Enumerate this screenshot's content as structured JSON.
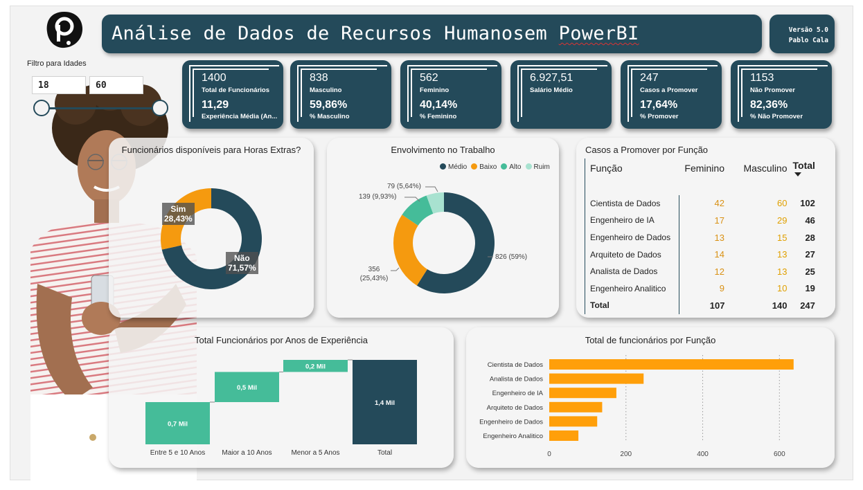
{
  "header": {
    "title": "Análise de Dados de Recursos Humanos",
    "title_suffix": "em ",
    "title_brand": "PowerBI",
    "version": "Versão 5.0",
    "author": "Pablo Cala"
  },
  "filter": {
    "label": "Filtro para Idades",
    "min_age": "18",
    "max_age": "60"
  },
  "kpis": [
    {
      "value": "1400",
      "label": "Total de Funcionários",
      "value2": "11,29",
      "label2": "Experiência Média (An..."
    },
    {
      "value": "838",
      "label": "Masculino",
      "value2": "59,86%",
      "label2": "% Masculino"
    },
    {
      "value": "562",
      "label": "Feminino",
      "value2": "40,14%",
      "label2": "% Feminino"
    },
    {
      "value": "6.927,51",
      "label": "Salário Médio",
      "value2": "",
      "label2": ""
    },
    {
      "value": "247",
      "label": "Casos a Promover",
      "value2": "17,64%",
      "label2": "% Promover"
    },
    {
      "value": "1153",
      "label": "Não Promover",
      "value2": "82,36%",
      "label2": "% Não Promover"
    }
  ],
  "colors": {
    "navy": "#244a5a",
    "orange": "#f59a0f",
    "teal": "#45bc99",
    "mint": "#a8e2d0",
    "bar": "#ff9f0a"
  },
  "chart_data": [
    {
      "type": "pie",
      "title": "Funcionários disponíveis para Horas Extras?",
      "categories": [
        "Sim",
        "Não"
      ],
      "values": [
        28.43,
        71.57
      ],
      "labels": [
        "Sim\n28,43%",
        "Não\n71,57%"
      ]
    },
    {
      "type": "pie",
      "title": "Envolvimento no Trabalho",
      "categories": [
        "Médio",
        "Baixo",
        "Alto",
        "Ruim"
      ],
      "values": [
        826,
        356,
        139,
        79
      ],
      "labels": [
        "826 (59%)",
        "356 (25,43%)",
        "139 (9,93%)",
        "79 (5,64%)"
      ],
      "legend": "top-right"
    },
    {
      "type": "table",
      "title": "Casos a Promover por Função",
      "columns": [
        "Função",
        "Feminino",
        "Masculino",
        "Total"
      ],
      "rows": [
        [
          "Cientista de Dados",
          "42",
          "60",
          "102"
        ],
        [
          "Engenheiro de IA",
          "17",
          "29",
          "46"
        ],
        [
          "Engenheiro de Dados",
          "13",
          "15",
          "28"
        ],
        [
          "Arquiteto de Dados",
          "14",
          "13",
          "27"
        ],
        [
          "Analista de Dados",
          "12",
          "13",
          "25"
        ],
        [
          "Engenheiro Analitico",
          "9",
          "10",
          "19"
        ]
      ],
      "total": [
        "Total",
        "107",
        "140",
        "247"
      ]
    },
    {
      "type": "bar",
      "subtype": "waterfall",
      "title": "Total Funcionários por Anos de Experiência",
      "categories": [
        "Entre 5 e 10 Anos",
        "Maior a 10 Anos",
        "Menor a 5 Anos",
        "Total"
      ],
      "values": [
        700,
        500,
        200,
        1400
      ],
      "labels": [
        "0,7 Mil",
        "0,5 Mil",
        "0,2 Mil",
        "1,4 Mil"
      ]
    },
    {
      "type": "bar",
      "orientation": "horizontal",
      "title": "Total de funcionários por Função",
      "categories": [
        "Cientista de Dados",
        "Analista de Dados",
        "Engenheiro de IA",
        "Arquiteto de Dados",
        "Engenheiro de Dados",
        "Engenheiro Analitico"
      ],
      "values": [
        637,
        246,
        175,
        138,
        125,
        76
      ],
      "xlim": [
        0,
        650
      ],
      "xticks": [
        "0",
        "200",
        "400",
        "600"
      ],
      "grid": true
    }
  ]
}
